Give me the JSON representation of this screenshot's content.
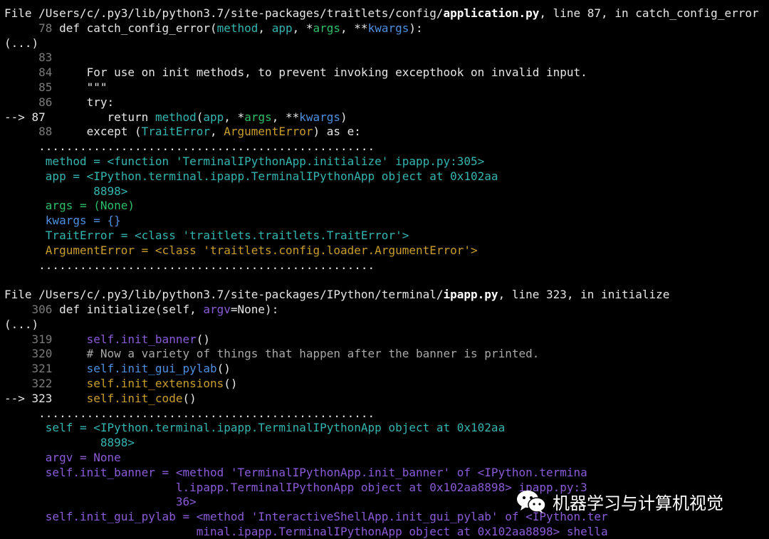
{
  "terminal": {
    "lines": [
      {
        "segs": [
          {
            "t": "File /Users/c/.py3/lib/python3.7/site-packages/traitlets/config/",
            "c": "w"
          },
          {
            "t": "application.py",
            "c": "b"
          },
          {
            "t": ", line 87, in catch_config_error",
            "c": "w"
          }
        ]
      },
      {
        "segs": [
          {
            "t": "     78 ",
            "c": "g"
          },
          {
            "t": "def catch_config_error(",
            "c": "w"
          },
          {
            "t": "method",
            "c": "c"
          },
          {
            "t": ", ",
            "c": "w"
          },
          {
            "t": "app",
            "c": "c"
          },
          {
            "t": ", *",
            "c": "w"
          },
          {
            "t": "args",
            "c": "gr"
          },
          {
            "t": ", **",
            "c": "w"
          },
          {
            "t": "kwargs",
            "c": "bl"
          },
          {
            "t": "):",
            "c": "w"
          }
        ]
      },
      {
        "segs": [
          {
            "t": "(...)",
            "c": "w"
          }
        ]
      },
      {
        "segs": [
          {
            "t": "     83",
            "c": "g"
          }
        ]
      },
      {
        "segs": [
          {
            "t": "     84 ",
            "c": "g"
          },
          {
            "t": "    For use on init methods, to prevent invoking excepthook on invalid input.",
            "c": "w"
          }
        ]
      },
      {
        "segs": [
          {
            "t": "     85 ",
            "c": "g"
          },
          {
            "t": "    \"\"\"",
            "c": "w"
          }
        ]
      },
      {
        "segs": [
          {
            "t": "     86 ",
            "c": "g"
          },
          {
            "t": "    try:",
            "c": "w"
          }
        ]
      },
      {
        "segs": [
          {
            "t": "--> 87 ",
            "c": "w"
          },
          {
            "t": "        return ",
            "c": "w"
          },
          {
            "t": "method",
            "c": "c"
          },
          {
            "t": "(",
            "c": "w"
          },
          {
            "t": "app",
            "c": "c"
          },
          {
            "t": ", *",
            "c": "w"
          },
          {
            "t": "args",
            "c": "gr"
          },
          {
            "t": ", **",
            "c": "w"
          },
          {
            "t": "kwargs",
            "c": "bl"
          },
          {
            "t": ")",
            "c": "w"
          }
        ]
      },
      {
        "segs": [
          {
            "t": "     88 ",
            "c": "g"
          },
          {
            "t": "    except (",
            "c": "w"
          },
          {
            "t": "TraitError",
            "c": "c"
          },
          {
            "t": ", ",
            "c": "w"
          },
          {
            "t": "ArgumentError",
            "c": "y"
          },
          {
            "t": ") as e:",
            "c": "w"
          }
        ]
      },
      {
        "segs": [
          {
            "t": "     .................................................",
            "c": "w"
          }
        ]
      },
      {
        "segs": [
          {
            "t": "      method = <function 'TerminalIPythonApp.initialize' ipapp.py:305>",
            "c": "c"
          }
        ]
      },
      {
        "segs": [
          {
            "t": "      app = <IPython.terminal.ipapp.TerminalIPythonApp object at 0x102aa",
            "c": "c"
          }
        ]
      },
      {
        "segs": [
          {
            "t": "             8898>",
            "c": "c"
          }
        ]
      },
      {
        "segs": [
          {
            "t": "      args = (None)",
            "c": "gr"
          }
        ]
      },
      {
        "segs": [
          {
            "t": "      kwargs = {}",
            "c": "bl"
          }
        ]
      },
      {
        "segs": [
          {
            "t": "      TraitError = <class 'traitlets.traitlets.TraitError'>",
            "c": "c"
          }
        ]
      },
      {
        "segs": [
          {
            "t": "      ArgumentError = <class 'traitlets.config.loader.ArgumentError'>",
            "c": "y"
          }
        ]
      },
      {
        "segs": [
          {
            "t": "     .................................................",
            "c": "w"
          }
        ]
      },
      {
        "segs": []
      },
      {
        "segs": [
          {
            "t": "File /Users/c/.py3/lib/python3.7/site-packages/IPython/terminal/",
            "c": "w"
          },
          {
            "t": "ipapp.py",
            "c": "b"
          },
          {
            "t": ", line 323, in initialize",
            "c": "w"
          }
        ]
      },
      {
        "segs": [
          {
            "t": "    306 ",
            "c": "g"
          },
          {
            "t": "def initialize(self, ",
            "c": "w"
          },
          {
            "t": "argv",
            "c": "p"
          },
          {
            "t": "=None):",
            "c": "w"
          }
        ]
      },
      {
        "segs": [
          {
            "t": "(...)",
            "c": "w"
          }
        ]
      },
      {
        "segs": [
          {
            "t": "    319 ",
            "c": "g"
          },
          {
            "t": "    ",
            "c": "w"
          },
          {
            "t": "self.init_banner",
            "c": "p"
          },
          {
            "t": "()",
            "c": "w"
          }
        ]
      },
      {
        "segs": [
          {
            "t": "    320 ",
            "c": "g"
          },
          {
            "t": "    # Now a variety of things that happen after the banner is printed.",
            "c": "cm"
          }
        ]
      },
      {
        "segs": [
          {
            "t": "    321 ",
            "c": "g"
          },
          {
            "t": "    ",
            "c": "w"
          },
          {
            "t": "self.init_gui_pylab",
            "c": "bl"
          },
          {
            "t": "()",
            "c": "w"
          }
        ]
      },
      {
        "segs": [
          {
            "t": "    322 ",
            "c": "g"
          },
          {
            "t": "    ",
            "c": "w"
          },
          {
            "t": "self.init_extensions",
            "c": "y"
          },
          {
            "t": "()",
            "c": "w"
          }
        ]
      },
      {
        "segs": [
          {
            "t": "--> 323 ",
            "c": "w"
          },
          {
            "t": "    ",
            "c": "w"
          },
          {
            "t": "self.init_code",
            "c": "y"
          },
          {
            "t": "()",
            "c": "w"
          }
        ]
      },
      {
        "segs": [
          {
            "t": "     .................................................",
            "c": "w"
          }
        ]
      },
      {
        "segs": [
          {
            "t": "      self = <IPython.terminal.ipapp.TerminalIPythonApp object at 0x102aa",
            "c": "c"
          }
        ]
      },
      {
        "segs": [
          {
            "t": "              8898>",
            "c": "c"
          }
        ]
      },
      {
        "segs": [
          {
            "t": "      argv = None",
            "c": "p"
          }
        ]
      },
      {
        "segs": [
          {
            "t": "      self.init_banner = <method 'TerminalIPythonApp.init_banner' of <IPython.termina",
            "c": "p"
          }
        ]
      },
      {
        "segs": [
          {
            "t": "                         l.ipapp.TerminalIPythonApp object at 0x102aa8898> ipapp.py:3",
            "c": "p"
          }
        ]
      },
      {
        "segs": [
          {
            "t": "                         36>",
            "c": "p"
          }
        ]
      },
      {
        "segs": [
          {
            "t": "      self.init_gui_pylab = <method 'InteractiveShellApp.init_gui_pylab' of <IPython.ter",
            "c": "p"
          }
        ]
      },
      {
        "segs": [
          {
            "t": "                            minal.ipapp.TerminalIPythonApp object at 0x102aa8898> shella",
            "c": "p"
          }
        ]
      }
    ]
  },
  "watermark": {
    "icon": "wechat-icon",
    "text": "机器学习与计算机视觉"
  },
  "colors": {
    "background": "#000000",
    "default": "#e6e6e6",
    "line_numbers": "#7a7a7a",
    "cyan": "#33b5b0",
    "yellow": "#c89e2a",
    "blue": "#4d8fe0",
    "green": "#2dbf6a",
    "purple": "#8a5bd6"
  }
}
